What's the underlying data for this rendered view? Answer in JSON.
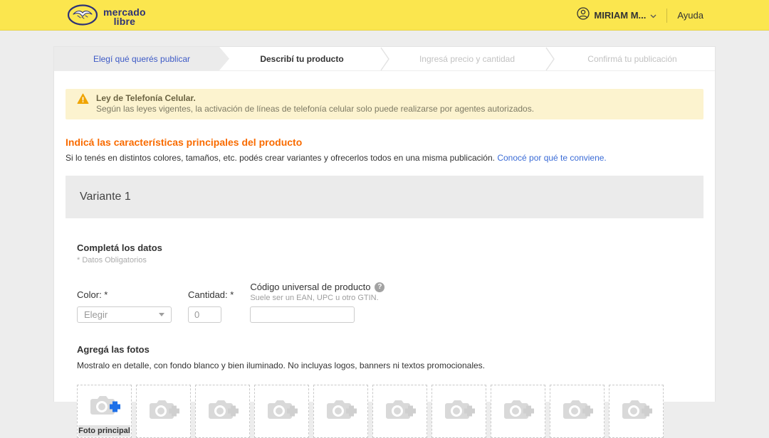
{
  "header": {
    "logo": {
      "line1": "mercado",
      "line2": "libre"
    },
    "user_label": "MIRIAM M...",
    "help_label": "Ayuda"
  },
  "steps": [
    {
      "label": "Elegí qué querés publicar",
      "state": "done"
    },
    {
      "label": "Describí tu producto",
      "state": "active"
    },
    {
      "label": "Ingresá precio y cantidad",
      "state": "pending"
    },
    {
      "label": "Confirmá tu publicación",
      "state": "pending"
    }
  ],
  "warning": {
    "title": "Ley de Telefonía Celular.",
    "body": "Según las leyes vigentes, la activación de líneas de telefonía celular solo puede realizarse por agentes autorizados."
  },
  "main": {
    "title": "Indicá las características principales del producto",
    "subtitle": "Si lo tenés en distintos colores, tamaños, etc. podés crear variantes y ofrecerlos todos en una misma publicación.",
    "subtitle_link": "Conocé por qué te conviene.",
    "variant": {
      "title": "Variante 1"
    },
    "form": {
      "section_title": "Completá los datos",
      "required_note": "* Datos Obligatorios",
      "color": {
        "label": "Color: *",
        "value": "Elegir"
      },
      "quantity": {
        "label": "Cantidad: *",
        "value": "0"
      },
      "upc": {
        "label": "Código universal de producto",
        "hint": "Suele ser un EAN, UPC u otro GTIN.",
        "value": "",
        "help_icon": "?"
      }
    },
    "photos": {
      "section_title": "Agregá las fotos",
      "subtitle": "Mostralo en detalle, con fondo blanco y bien iluminado. No incluyas logos, banners ni textos promocionales.",
      "main_photo_label": "Foto principal",
      "slot_count": 10
    }
  },
  "colors": {
    "brand_yellow": "#fbe64e",
    "logo_navy": "#2d3277",
    "accent_orange": "#f96b00",
    "link_blue": "#3a6bd6",
    "step_done_blue": "#3d5ac6",
    "warning_bg": "#fcf3cf",
    "warning_icon": "#f0a400",
    "plus_blue": "#1e70e8",
    "camera_gray": "#d9d9d9"
  }
}
